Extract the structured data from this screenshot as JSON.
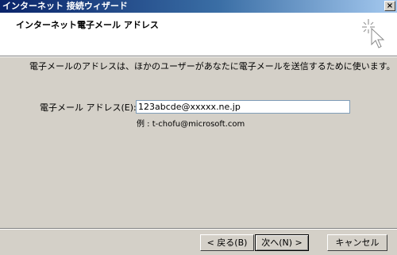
{
  "window": {
    "title": "インターネット 接続ウィザード",
    "close_glyph": "×"
  },
  "header": {
    "title": "インターネット電子メール アドレス",
    "icon": "wizard-sparkle-cursor-icon"
  },
  "main": {
    "description": "電子メールのアドレスは、ほかのユーザーがあなたに電子メールを送信するために使います。",
    "email_label": "電子メール アドレス(E):",
    "email_value": "123abcde@xxxxx.ne.jp",
    "example": "例 : t-chofu@microsoft.com"
  },
  "footer": {
    "back_label": "< 戻る(B)",
    "next_label": "次へ(N) >",
    "cancel_label": "キャンセル"
  },
  "colors": {
    "titlebar_start": "#0a246a",
    "titlebar_end": "#a6caf0",
    "face": "#d4d0c8",
    "header_bg": "#ffffff"
  }
}
